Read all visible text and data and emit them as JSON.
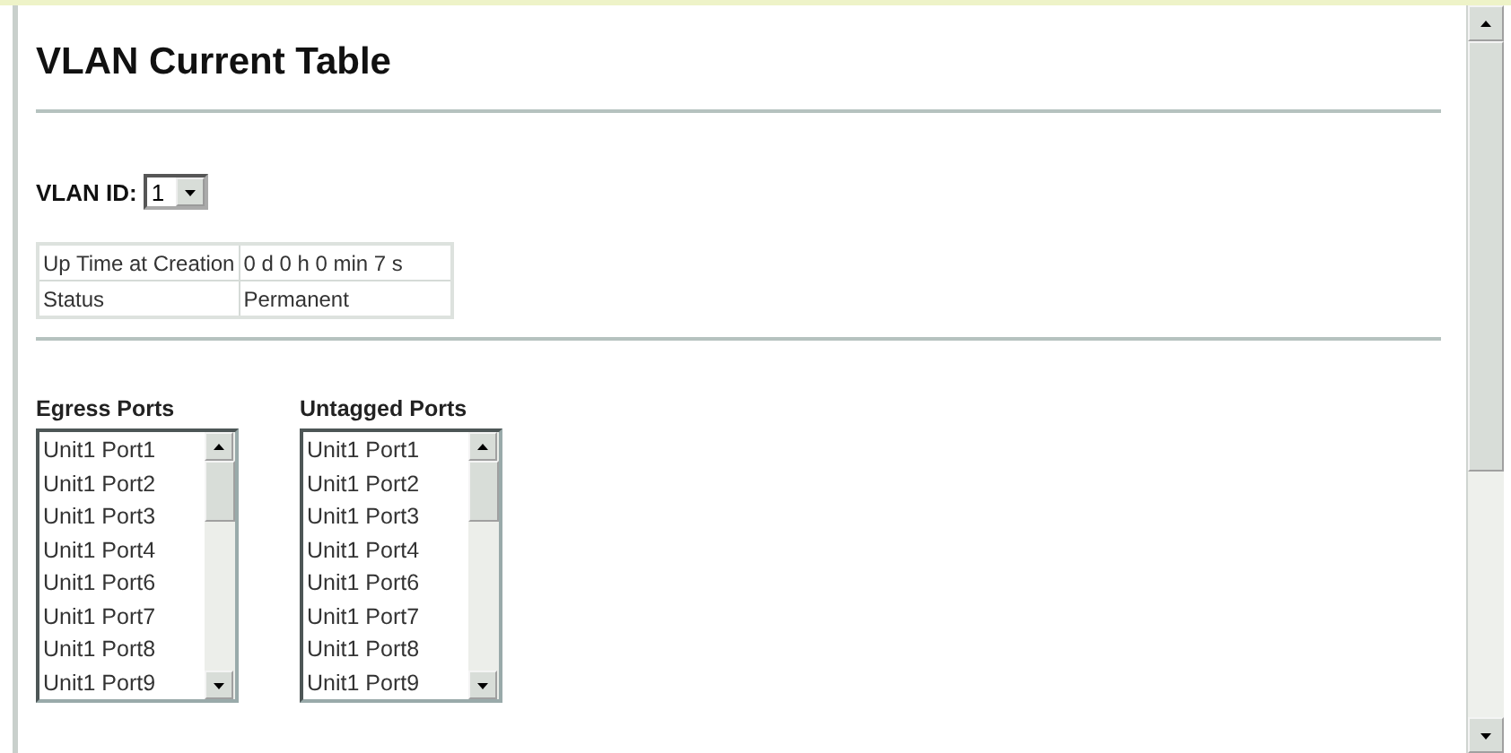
{
  "title": "VLAN Current Table",
  "vlan_id": {
    "label": "VLAN ID:",
    "value": "1"
  },
  "info_table": {
    "rows": [
      {
        "label": "Up Time at Creation",
        "value": "0 d 0 h 0 min 7 s"
      },
      {
        "label": "Status",
        "value": "Permanent"
      }
    ]
  },
  "port_lists": [
    {
      "heading": "Egress Ports",
      "items": [
        "Unit1 Port1",
        "Unit1 Port2",
        "Unit1 Port3",
        "Unit1 Port4",
        "Unit1 Port6",
        "Unit1 Port7",
        "Unit1 Port8",
        "Unit1 Port9"
      ]
    },
    {
      "heading": "Untagged Ports",
      "items": [
        "Unit1 Port1",
        "Unit1 Port2",
        "Unit1 Port3",
        "Unit1 Port4",
        "Unit1 Port6",
        "Unit1 Port7",
        "Unit1 Port8",
        "Unit1 Port9"
      ]
    }
  ]
}
